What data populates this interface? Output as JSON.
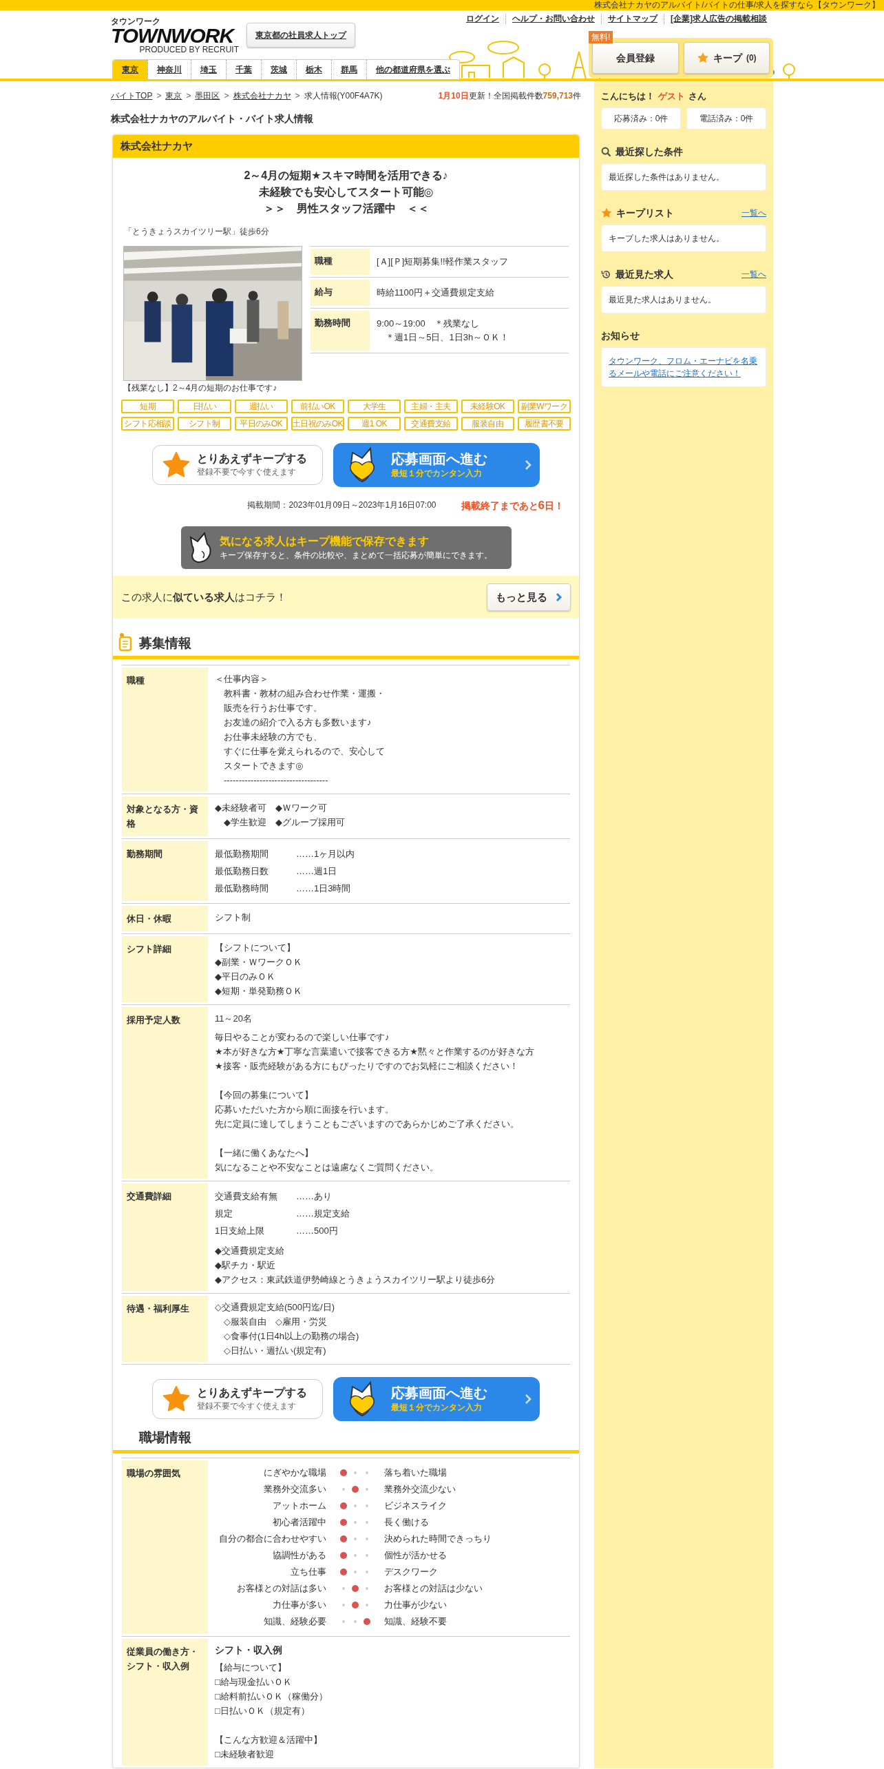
{
  "top_strip": "株式会社ナカヤのアルバイト/バイトの仕事/求人を探すなら【タウンワーク】",
  "header": {
    "logo_kana": "タウンワーク",
    "logo": "TOWNWORK",
    "logo_credit": "PRODUCED BY",
    "logo_credit_brand": "RECRUIT",
    "corporate_link": "東京都の社員求人トップ",
    "links": [
      "ログイン",
      "ヘルプ・お問い合わせ",
      "サイトマップ",
      "[企業]求人広告の掲載相談"
    ],
    "free_badge": "無料!",
    "register_button": "会員登録",
    "keep_button": "キープ",
    "keep_count": "(0)"
  },
  "prefectures": [
    {
      "label": "東京",
      "selected": true
    },
    {
      "label": "神奈川",
      "selected": false
    },
    {
      "label": "埼玉",
      "selected": false
    },
    {
      "label": "千葉",
      "selected": false
    },
    {
      "label": "茨城",
      "selected": false
    },
    {
      "label": "栃木",
      "selected": false
    },
    {
      "label": "群馬",
      "selected": false
    },
    {
      "label": "他の都道府県を選ぶ",
      "selected": false
    }
  ],
  "breadcrumb": [
    {
      "label": "バイトTOP",
      "link": true
    },
    {
      "separator": ">",
      "label": "東京",
      "link": true
    },
    {
      "separator": ">",
      "label": "墨田区",
      "link": true
    },
    {
      "separator": ">",
      "label": "株式会社ナカヤ",
      "link": true
    },
    {
      "separator": ">",
      "label": "求人情報(Y00F4A7K)",
      "link": false
    }
  ],
  "update_notice": {
    "date": "1月10日",
    "text": "更新！全国掲載件数",
    "count": "759,713",
    "unit": "件"
  },
  "page_title": "株式会社ナカヤのアルバイト・バイト求人情報",
  "job": {
    "company": "株式会社ナカヤ",
    "headline": [
      "2～4月の短期★スキマ時間を活用できる♪",
      "未経験でも安心してスタート可能◎",
      "＞＞　男性スタッフ活躍中　＜＜"
    ],
    "station": "「とうきょうスカイツリー駅」徒歩6分",
    "photo": {
      "kind": "picture",
      "caption": "【残業なし】2～4月の短期のお仕事です♪"
    },
    "summary": [
      {
        "label": "職種",
        "lines": [
          "[Ａ][Ｐ]短期募集!!軽作業スタッフ"
        ]
      },
      {
        "label": "給与",
        "lines": [
          "時給1100円＋交通費規定支給"
        ]
      },
      {
        "label": "勤務時間",
        "lines": [
          "9:00～19:00　＊残業なし",
          "　＊週1日～5日、1日3h～ＯＫ！"
        ]
      }
    ],
    "tags": [
      "短期",
      "日払い",
      "週払い",
      "前払いOK",
      "大学生",
      "主婦・主夫",
      "未経験OK",
      "副業Wワーク",
      "シフト応相談",
      "シフト制",
      "平日のみOK",
      "土日祝のみOK",
      "週1 OK",
      "交通費支給",
      "服装自由",
      "履歴書不要"
    ],
    "actions": {
      "keep_title": "とりあえずキープする",
      "keep_sub": "登録不要で今すぐ使えます",
      "apply_title": "応募画面へ進む",
      "apply_sub": "最短１分でカンタン入力"
    },
    "period": "掲載期間：2023年01月09日～2023年1月16日07:00",
    "remaining": {
      "before": "掲載終了まであと",
      "days": "6",
      "after": "日！"
    },
    "keep_banner": {
      "title": "気になる求人はキープ機能で保存できます",
      "sub": "キープ保存すると、条件の比較や、まとめて一括応募が簡単にできます。"
    },
    "similar": {
      "text": "この求人に**似ている求人**はコチラ！",
      "button": "もっと見る"
    }
  },
  "recruitment": {
    "title": "募集情報",
    "rows": [
      {
        "label": "職種",
        "blocks": [
          {
            "kind": "lines",
            "lines": [
              "＜仕事内容＞",
              "　教科書・教材の組み合わせ作業・運搬・",
              "　販売を行うお仕事です。",
              "　お友達の紹介で入る方も多数います♪",
              "　お仕事未経験の方でも、",
              "　すぐに仕事を覚えられるので、安心して",
              "　スタートできます◎",
              "　-----------------------------------"
            ]
          }
        ]
      },
      {
        "label": "対象となる方・資格",
        "blocks": [
          {
            "kind": "lines",
            "lines": [
              "◆未経験者可　◆Ｗワーク可",
              "　◆学生歓迎　◆グループ採用可"
            ]
          }
        ]
      },
      {
        "label": "勤務期間",
        "blocks": [
          {
            "kind": "pairs",
            "items": [
              {
                "key": "最低勤務期間",
                "value": "……1ヶ月以内"
              },
              {
                "key": "最低勤務日数",
                "value": "……週1日"
              },
              {
                "key": "最低勤務時間",
                "value": "……1日3時間"
              }
            ]
          }
        ]
      },
      {
        "label": "休日・休暇",
        "blocks": [
          {
            "kind": "lines",
            "lines": [
              "シフト制"
            ]
          }
        ]
      },
      {
        "label": "シフト詳細",
        "blocks": [
          {
            "kind": "lines",
            "lines": [
              "【シフトについて】",
              "◆副業・ＷワークＯＫ",
              "◆平日のみＯＫ",
              "◆短期・単発勤務ＯＫ"
            ]
          }
        ]
      },
      {
        "label": "採用予定人数",
        "blocks": [
          {
            "kind": "lines",
            "lines": [
              "11～20名"
            ]
          },
          {
            "kind": "lines",
            "lines": [
              "毎日やることが変わるので楽しい仕事です♪",
              "★本が好きな方★丁寧な言葉遣いで接客できる方★黙々と作業するのが好きな方",
              "★接客・販売経験がある方にもぴったりですのでお気軽にご相談ください！"
            ]
          },
          {
            "kind": "paragraph",
            "lines": [
              "【今回の募集について】",
              "応募いただいた方から順に面接を行います。",
              "先に定員に達してしまうこともございますのであらかじめご了承ください。"
            ]
          },
          {
            "kind": "paragraph",
            "lines": [
              "【一緒に働くあなたへ】",
              "気になることや不安なことは遠慮なくご質問ください。"
            ]
          }
        ]
      },
      {
        "label": "交通費詳細",
        "blocks": [
          {
            "kind": "pairs",
            "items": [
              {
                "key": "交通費支給有無",
                "value": "……あり"
              },
              {
                "key": "規定",
                "value": "……規定支給"
              },
              {
                "key": "1日支給上限",
                "value": "……500円"
              }
            ]
          },
          {
            "kind": "lines",
            "lines": [
              "◆交通費規定支給",
              "◆駅チカ・駅近",
              "◆アクセス：東武鉄道伊勢崎線とうきょうスカイツリー駅より徒歩6分"
            ]
          }
        ]
      },
      {
        "label": "待遇・福利厚生",
        "blocks": [
          {
            "kind": "lines",
            "lines": [
              "◇交通費規定支給(500円迄/日)",
              "　◇服装自由　◇雇用・労災",
              "　◇食事付(1日4h以上の勤務の場合)",
              "　◇日払い・週払い(規定有)"
            ]
          }
        ]
      }
    ]
  },
  "actions_bottom": {
    "keep_title": "とりあえずキープする",
    "keep_sub": "登録不要で今すぐ使えます",
    "apply_title": "応募画面へ進む",
    "apply_sub": "最短１分でカンタン入力"
  },
  "workplace": {
    "title": "職場情報",
    "atmosphere_label": "職場の雰囲気",
    "atmosphere": [
      {
        "left": "にぎやかな職場",
        "right": "落ち着いた職場",
        "points": [
          {
            "selected": true
          },
          {
            "selected": false
          },
          {
            "selected": false
          }
        ]
      },
      {
        "left": "業務外交流多い",
        "right": "業務外交流少ない",
        "points": [
          {
            "selected": false
          },
          {
            "selected": true
          },
          {
            "selected": false
          }
        ]
      },
      {
        "left": "アットホーム",
        "right": "ビジネスライク",
        "points": [
          {
            "selected": true
          },
          {
            "selected": false
          },
          {
            "selected": false
          }
        ]
      },
      {
        "left": "初心者活躍中",
        "right": "長く働ける",
        "points": [
          {
            "selected": true
          },
          {
            "selected": false
          },
          {
            "selected": false
          }
        ]
      },
      {
        "left": "自分の都合に合わせやすい",
        "right": "決められた時間できっちり",
        "points": [
          {
            "selected": true
          },
          {
            "selected": false
          },
          {
            "selected": false
          }
        ]
      },
      {
        "left": "協調性がある",
        "right": "個性が活かせる",
        "points": [
          {
            "selected": true
          },
          {
            "selected": false
          },
          {
            "selected": false
          }
        ]
      },
      {
        "left": "立ち仕事",
        "right": "デスクワーク",
        "points": [
          {
            "selected": true
          },
          {
            "selected": false
          },
          {
            "selected": false
          }
        ]
      },
      {
        "left": "お客様との対話は多い",
        "right": "お客様との対話は少ない",
        "points": [
          {
            "selected": false
          },
          {
            "selected": true
          },
          {
            "selected": false
          }
        ]
      },
      {
        "left": "力仕事が多い",
        "right": "力仕事が少ない",
        "points": [
          {
            "selected": false
          },
          {
            "selected": true
          },
          {
            "selected": false
          }
        ]
      },
      {
        "left": "知識、経験必要",
        "right": "知識、経験不要",
        "points": [
          {
            "selected": false
          },
          {
            "selected": false
          },
          {
            "selected": true
          }
        ]
      }
    ],
    "employee_label": "従業員の働き方・シフト・収入例",
    "employee_heading": "シフト・収入例",
    "employee_blocks": [
      {
        "kind": "lines",
        "lines": [
          "【給与について】",
          "□給与現金払いＯＫ",
          "□給料前払いＯＫ（稼働分）",
          "□日払いＯＫ（規定有）"
        ]
      },
      {
        "kind": "paragraph",
        "lines": [
          "【こんな方歓迎＆活躍中】",
          "□未経験者歓迎"
        ]
      }
    ]
  },
  "sidebar": {
    "greeting": {
      "before": "こんにちは！",
      "name": "ゲスト",
      "after": "さん"
    },
    "counters": [
      "応募済み：0件",
      "電話済み：0件"
    ],
    "sections": [
      {
        "kind": "search",
        "title": "最近探した条件",
        "body": "最近探した条件はありません。"
      },
      {
        "kind": "star",
        "title": "キープリスト",
        "link": "一覧へ",
        "body": "キープした求人はありません。"
      },
      {
        "kind": "history",
        "title": "最近見た求人",
        "link": "一覧へ",
        "body": "最近見た求人はありません。"
      },
      {
        "kind": "notice",
        "title": "お知らせ",
        "body": "タウンワーク、フロム・エーナビを名乗るメールや電話にご注意ください！"
      }
    ]
  }
}
